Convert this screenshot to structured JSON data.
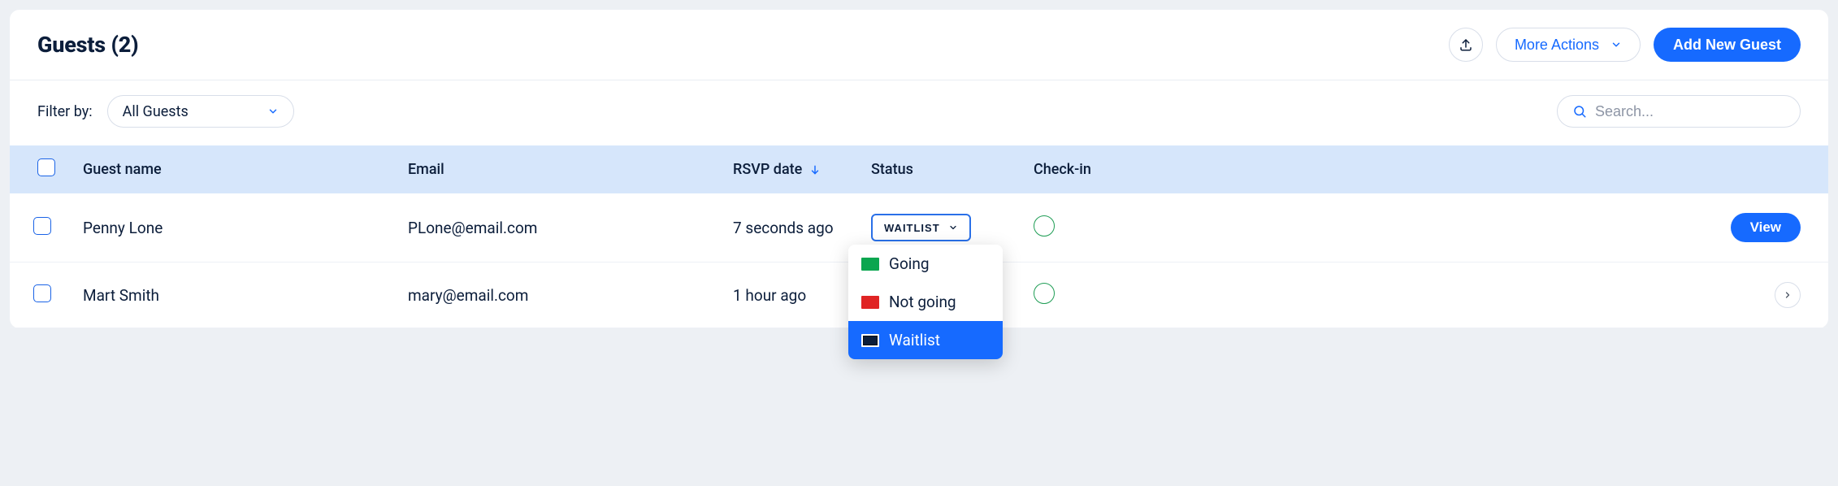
{
  "header": {
    "title": "Guests (2)",
    "more_actions_label": "More Actions",
    "add_guest_label": "Add New Guest"
  },
  "filter": {
    "label": "Filter by:",
    "selected": "All Guests"
  },
  "search": {
    "placeholder": "Search..."
  },
  "columns": {
    "name": "Guest name",
    "email": "Email",
    "rsvp": "RSVP date",
    "status": "Status",
    "checkin": "Check-in"
  },
  "rows": [
    {
      "name": "Penny Lone",
      "email": "PLone@email.com",
      "rsvp": "7 seconds ago",
      "status": "WAITLIST",
      "action_label": "View"
    },
    {
      "name": "Mart Smith",
      "email": "mary@email.com",
      "rsvp": "1 hour ago",
      "status": "",
      "action_label": ""
    }
  ],
  "status_options": {
    "going": "Going",
    "not_going": "Not going",
    "waitlist": "Waitlist"
  }
}
